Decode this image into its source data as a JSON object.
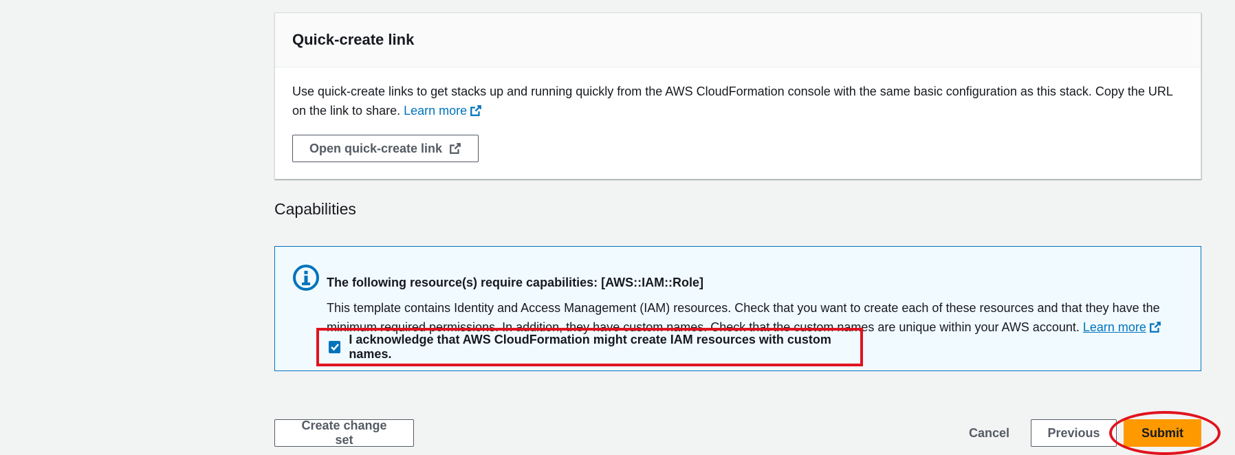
{
  "quick_create": {
    "title": "Quick-create link",
    "description": "Use quick-create links to get stacks up and running quickly from the AWS CloudFormation console with the same basic configuration as this stack. Copy the URL on the link to share.",
    "learn_more": "Learn more",
    "open_button": "Open quick-create link"
  },
  "capabilities": {
    "section_title": "Capabilities",
    "alert_title": "The following resource(s) require capabilities: [AWS::IAM::Role]",
    "alert_text": "This template contains Identity and Access Management (IAM) resources. Check that you want to create each of these resources and that they have the minimum required permissions. In addition, they have custom names. Check that the custom names are unique within your AWS account.",
    "learn_more": "Learn more",
    "acknowledge_label": "I acknowledge that AWS CloudFormation might create IAM resources with custom names.",
    "acknowledge_checked": true
  },
  "footer": {
    "create_change_set": "Create change set",
    "cancel": "Cancel",
    "previous": "Previous",
    "submit": "Submit"
  },
  "colors": {
    "link": "#0073bb",
    "primary_button": "#ff9900",
    "annotation": "#e0131e",
    "info_bg": "#f1faff"
  },
  "icons": [
    "external-link-icon",
    "info-icon",
    "checkmark-icon"
  ]
}
